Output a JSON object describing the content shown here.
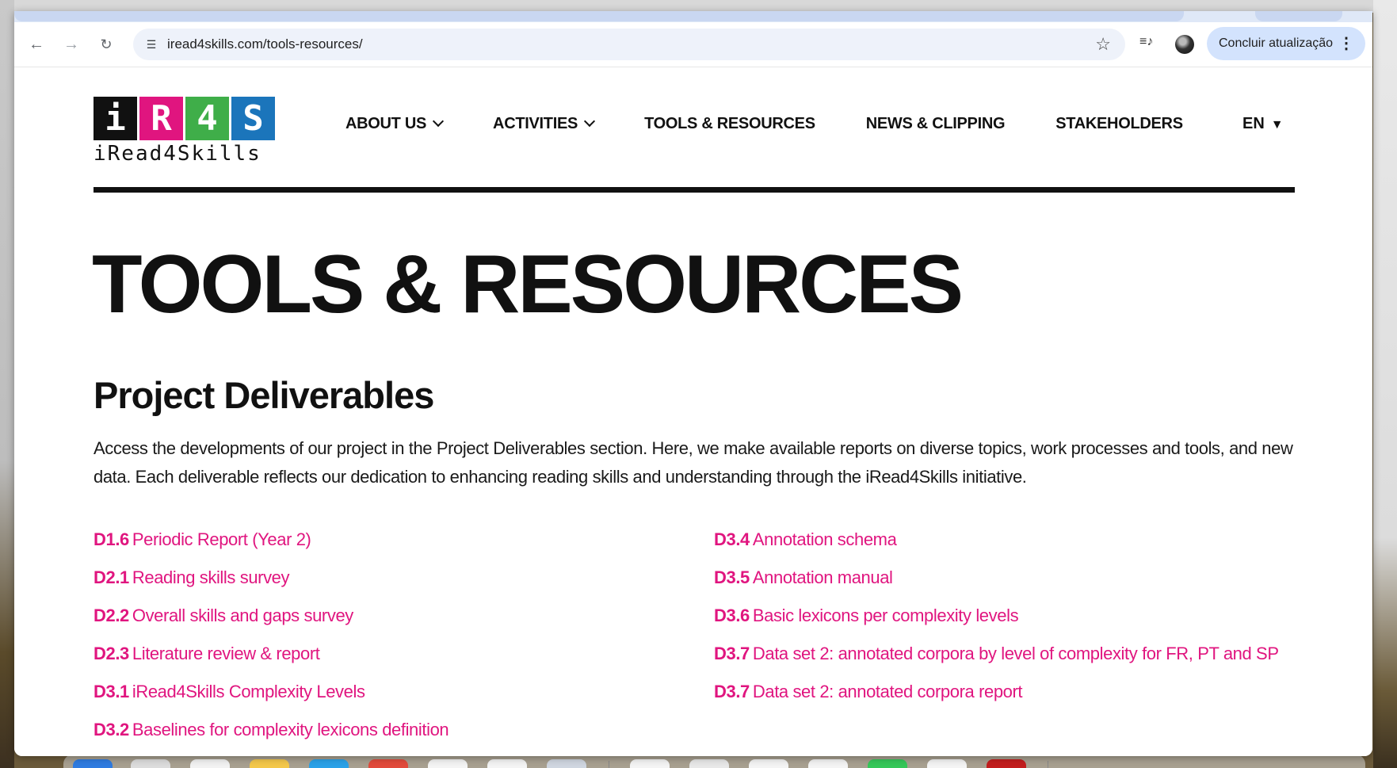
{
  "browser": {
    "url": "iread4skills.com/tools-resources/",
    "update_label": "Concluir atualização",
    "nav": {
      "back_icon": "arrow-left-icon",
      "forward_icon": "arrow-right-icon",
      "reload_icon": "reload-icon"
    }
  },
  "site": {
    "logo_letters": [
      "i",
      "R",
      "4",
      "S"
    ],
    "logo_colors": [
      "#111111",
      "#e0157f",
      "#3fae49",
      "#1b75bb"
    ],
    "logo_wordmark": "iRead4Skills",
    "menu": [
      {
        "label": "ABOUT US",
        "dropdown": true
      },
      {
        "label": "ACTIVITIES",
        "dropdown": true
      },
      {
        "label": "TOOLS & RESOURCES",
        "dropdown": false
      },
      {
        "label": "NEWS & CLIPPING",
        "dropdown": false
      },
      {
        "label": "STAKEHOLDERS",
        "dropdown": false
      }
    ],
    "language": "EN",
    "accent_color": "#e0157f"
  },
  "content": {
    "title": "TOOLS & RESOURCES",
    "section_title": "Project Deliverables",
    "intro": "Access the developments of our project in the Project Deliverables section. Here, we make available reports on diverse topics, work processes and tools, and new data. Each deliverable reflects our dedication to enhancing reading skills and understanding through the iRead4Skills initiative.",
    "deliverables_left": [
      {
        "code": "D1.6",
        "title": "Periodic Report (Year 2)"
      },
      {
        "code": "D2.1",
        "title": "Reading skills survey"
      },
      {
        "code": "D2.2",
        "title": "Overall skills and gaps survey"
      },
      {
        "code": "D2.3",
        "title": "Literature review & report"
      },
      {
        "code": "D3.1",
        "title": "iRead4Skills Complexity Levels"
      },
      {
        "code": "D3.2",
        "title": "Baselines for complexity lexicons definition"
      }
    ],
    "deliverables_right": [
      {
        "code": "D3.4",
        "title": "Annotation schema"
      },
      {
        "code": "D3.5",
        "title": "Annotation manual"
      },
      {
        "code": "D3.6",
        "title": "Basic lexicons per complexity levels"
      },
      {
        "code": "D3.7",
        "title": "Data set 2: annotated corpora by level of complexity for FR, PT and SP"
      },
      {
        "code": "D3.7",
        "title": "Data set 2: annotated corpora report"
      }
    ]
  }
}
